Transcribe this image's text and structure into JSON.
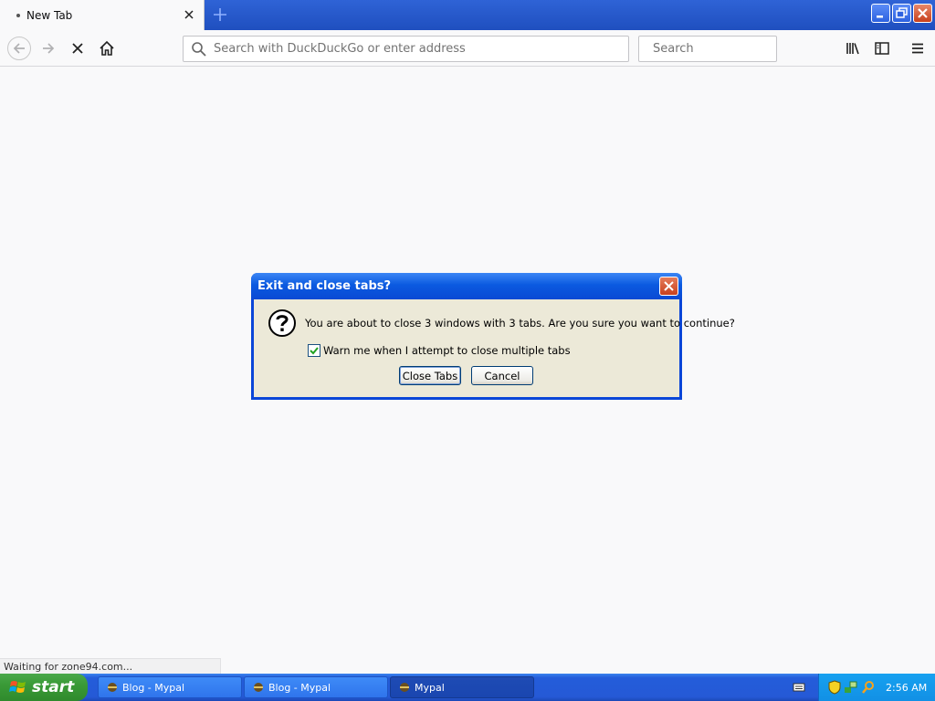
{
  "browser": {
    "tab": {
      "title": "New Tab"
    },
    "urlbar": {
      "placeholder": "Search with DuckDuckGo or enter address"
    },
    "searchbar": {
      "placeholder": "Search"
    },
    "status_text": "Waiting for zone94.com..."
  },
  "dialog": {
    "title": "Exit and close tabs?",
    "message": "You are about to close 3 windows with 3 tabs. Are you sure you want to continue?",
    "checkbox_label": "Warn me when I attempt to close multiple tabs",
    "checkbox_checked": true,
    "primary_button": "Close Tabs",
    "cancel_button": "Cancel"
  },
  "taskbar": {
    "start_label": "start",
    "items": [
      {
        "label": "Blog - Mypal"
      },
      {
        "label": "Blog - Mypal"
      },
      {
        "label": "Mypal"
      }
    ],
    "clock": "2:56 AM"
  },
  "colors": {
    "xp_blue": "#245dda",
    "dialog_bg": "#ece9d8",
    "start_green": "#3a9a37"
  }
}
